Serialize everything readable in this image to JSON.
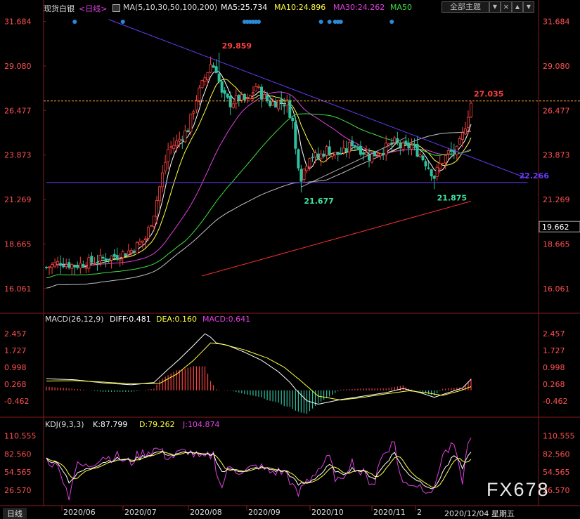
{
  "header": {
    "symbol": "现货白银",
    "period": "<日线>",
    "ma_label": "MA(5,10,30,50,100,200)",
    "ma5": "MA5:25.734",
    "ma10": "MA10:24.896",
    "ma30": "MA30:24.262",
    "ma50": "MA50",
    "theme_button": "全部主题",
    "theme_arrow": "▼"
  },
  "macd_header": {
    "label": "MACD(26,12,9)",
    "diff": "DIFF:0.481",
    "dea": "DEA:0.160",
    "macd": "MACD:0.641"
  },
  "kdj_header": {
    "label": "KDJ(9,3,3)",
    "k": "K:87.799",
    "d": "D:79.262",
    "j": "J:104.874"
  },
  "bottom": {
    "tab": "日线",
    "date": "2020/12/04 星期五",
    "watermark": "FX678"
  },
  "colors": {
    "up": "#ff4040",
    "down": "#30c0a0",
    "ma5": "#ffffff",
    "ma10": "#ffff40",
    "ma30": "#e040e0",
    "ma50": "#40e040",
    "ma100": "#c0c0c0",
    "ma200": "#ff3030",
    "trend": "#6a3cff",
    "price_level": "#ffa040"
  },
  "chart_data": [
    {
      "type": "candlestick",
      "x_ticks": [
        "2020/06",
        "2020/07",
        "2020/08",
        "2020/09",
        "2020/10",
        "2020/11",
        "2"
      ],
      "y_ticks": [
        "31.684",
        "29.080",
        "26.477",
        "23.873",
        "21.269",
        "18.665",
        "16.061"
      ],
      "ylim": [
        14.7,
        32.2
      ],
      "annotations": [
        {
          "label": "29.859",
          "x": 61,
          "y": 29.859
        },
        {
          "label": "21.677",
          "x": 90,
          "y": 21.677
        },
        {
          "label": "21.875",
          "x": 137,
          "y": 21.875
        },
        {
          "label": "27.035",
          "x": 150,
          "y": 27.035
        },
        {
          "label": "22.266",
          "x": 170,
          "y": 22.266
        }
      ],
      "current_price": "19.662",
      "anchors": [
        [
          0,
          17.3
        ],
        [
          5,
          17.6
        ],
        [
          10,
          17.4
        ],
        [
          15,
          17.6
        ],
        [
          20,
          17.8
        ],
        [
          25,
          18.0
        ],
        [
          30,
          18.3
        ],
        [
          35,
          19.0
        ],
        [
          38,
          20.5
        ],
        [
          40,
          22.0
        ],
        [
          43,
          24.2
        ],
        [
          46,
          24.6
        ],
        [
          50,
          25.4
        ],
        [
          53,
          27.2
        ],
        [
          56,
          28.4
        ],
        [
          58,
          29.2
        ],
        [
          60,
          28.9
        ],
        [
          62,
          27.4
        ],
        [
          65,
          26.9
        ],
        [
          68,
          27.2
        ],
        [
          71,
          27.0
        ],
        [
          74,
          27.9
        ],
        [
          76,
          27.4
        ],
        [
          79,
          26.9
        ],
        [
          82,
          27.0
        ],
        [
          85,
          26.9
        ],
        [
          87,
          25.8
        ],
        [
          88,
          24.2
        ],
        [
          90,
          22.6
        ],
        [
          93,
          23.9
        ],
        [
          96,
          23.7
        ],
        [
          99,
          24.2
        ],
        [
          102,
          23.9
        ],
        [
          105,
          24.0
        ],
        [
          108,
          24.6
        ],
        [
          111,
          24.2
        ],
        [
          114,
          23.8
        ],
        [
          117,
          24.0
        ],
        [
          120,
          24.3
        ],
        [
          123,
          24.6
        ],
        [
          126,
          24.3
        ],
        [
          129,
          24.4
        ],
        [
          132,
          23.9
        ],
        [
          135,
          23.2
        ],
        [
          137,
          22.6
        ],
        [
          139,
          23.3
        ],
        [
          142,
          24.0
        ],
        [
          145,
          24.1
        ],
        [
          147,
          25.0
        ],
        [
          149,
          26.3
        ],
        [
          150,
          26.9
        ]
      ],
      "trend_lines": [
        {
          "from": [
            22,
            31.8
          ],
          "to": [
            170,
            22.5
          ]
        },
        {
          "from": [
            0,
            22.266
          ],
          "to": [
            170,
            22.266
          ]
        },
        {
          "from": [
            90,
            22.0
          ],
          "to": [
            127,
            24.9
          ]
        }
      ],
      "horizontal_line": 27.035
    },
    {
      "type": "line",
      "name": "MACD",
      "y_ticks": [
        "2.457",
        "1.727",
        "0.998",
        "0.268",
        "-0.462"
      ],
      "ylim": [
        -1.1,
        2.85
      ],
      "diff_anchors": [
        [
          0,
          0.5
        ],
        [
          10,
          0.46
        ],
        [
          20,
          0.32
        ],
        [
          30,
          0.24
        ],
        [
          38,
          0.34
        ],
        [
          42,
          0.8
        ],
        [
          47,
          1.35
        ],
        [
          52,
          1.95
        ],
        [
          56,
          2.45
        ],
        [
          58,
          2.3
        ],
        [
          60,
          2.05
        ],
        [
          64,
          1.95
        ],
        [
          70,
          1.65
        ],
        [
          76,
          1.3
        ],
        [
          82,
          0.8
        ],
        [
          86,
          0.35
        ],
        [
          88,
          0.05
        ],
        [
          92,
          -0.45
        ],
        [
          96,
          -0.6
        ],
        [
          104,
          -0.4
        ],
        [
          112,
          -0.25
        ],
        [
          120,
          -0.1
        ],
        [
          126,
          0.08
        ],
        [
          132,
          -0.1
        ],
        [
          137,
          -0.3
        ],
        [
          142,
          -0.1
        ],
        [
          147,
          0.1
        ],
        [
          150,
          0.48
        ]
      ],
      "dea_anchors": [
        [
          0,
          0.4
        ],
        [
          10,
          0.42
        ],
        [
          20,
          0.36
        ],
        [
          30,
          0.28
        ],
        [
          40,
          0.3
        ],
        [
          46,
          0.7
        ],
        [
          52,
          1.3
        ],
        [
          58,
          2.05
        ],
        [
          62,
          2.0
        ],
        [
          70,
          1.75
        ],
        [
          78,
          1.4
        ],
        [
          84,
          1.0
        ],
        [
          90,
          0.4
        ],
        [
          96,
          -0.25
        ],
        [
          104,
          -0.42
        ],
        [
          112,
          -0.3
        ],
        [
          120,
          -0.15
        ],
        [
          128,
          -0.02
        ],
        [
          134,
          -0.1
        ],
        [
          140,
          -0.22
        ],
        [
          146,
          -0.02
        ],
        [
          150,
          0.16
        ]
      ]
    },
    {
      "type": "line",
      "name": "KDJ",
      "y_ticks": [
        "110.555",
        "82.560",
        "54.565",
        "26.570"
      ],
      "ylim": [
        5,
        122
      ],
      "k_anchors": [
        [
          0,
          75
        ],
        [
          5,
          65
        ],
        [
          8,
          40
        ],
        [
          12,
          55
        ],
        [
          16,
          62
        ],
        [
          20,
          70
        ],
        [
          25,
          75
        ],
        [
          30,
          72
        ],
        [
          35,
          80
        ],
        [
          40,
          86
        ],
        [
          45,
          80
        ],
        [
          50,
          86
        ],
        [
          55,
          80
        ],
        [
          59,
          82
        ],
        [
          62,
          55
        ],
        [
          66,
          60
        ],
        [
          70,
          55
        ],
        [
          75,
          62
        ],
        [
          80,
          58
        ],
        [
          85,
          55
        ],
        [
          89,
          35
        ],
        [
          93,
          40
        ],
        [
          97,
          52
        ],
        [
          100,
          65
        ],
        [
          104,
          50
        ],
        [
          108,
          60
        ],
        [
          112,
          55
        ],
        [
          116,
          45
        ],
        [
          120,
          70
        ],
        [
          123,
          85
        ],
        [
          126,
          60
        ],
        [
          130,
          45
        ],
        [
          134,
          35
        ],
        [
          137,
          28
        ],
        [
          140,
          55
        ],
        [
          144,
          80
        ],
        [
          147,
          62
        ],
        [
          150,
          88
        ]
      ]
    }
  ]
}
